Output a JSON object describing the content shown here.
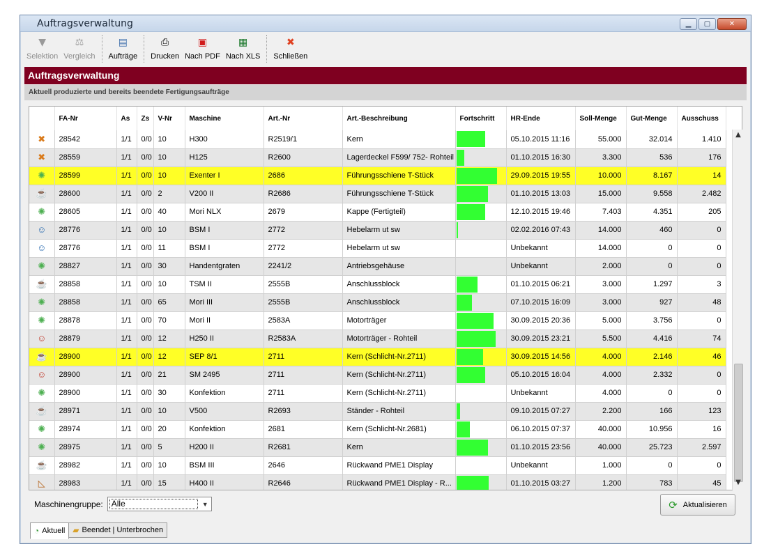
{
  "window": {
    "title": "Auftragsverwaltung"
  },
  "toolbar": [
    {
      "label": "Selektion",
      "icon": "funnel-icon",
      "glyph": "▼",
      "disabled": true
    },
    {
      "label": "Vergleich",
      "icon": "scales-icon",
      "glyph": "⚖",
      "disabled": true
    },
    {
      "label": "Aufträge",
      "icon": "orders-icon",
      "glyph": "▤",
      "disabled": false
    },
    {
      "label": "Drucken",
      "icon": "printer-icon",
      "glyph": "⎙",
      "disabled": false
    },
    {
      "label": "Nach PDF",
      "icon": "pdf-icon",
      "glyph": "▣",
      "disabled": false
    },
    {
      "label": "Nach XLS",
      "icon": "xls-icon",
      "glyph": "▦",
      "disabled": false
    },
    {
      "label": "Schließen",
      "icon": "close-circle-icon",
      "glyph": "✖",
      "disabled": false
    }
  ],
  "band": {
    "title": "Auftragsverwaltung",
    "subtitle": "Aktuell produzierte und bereits beendete Fertigungsaufträge"
  },
  "columns": [
    "",
    "FA-Nr",
    "As",
    "Zs",
    "V-Nr",
    "Maschine",
    "Art.-Nr",
    "Art.-Beschreibung",
    "Fortschritt",
    "HR-Ende",
    "Soll-Menge",
    "Gut-Menge",
    "Ausschuss"
  ],
  "rows": [
    {
      "icon": "stop-icon",
      "glyph": "✖",
      "color": "#d97a1a",
      "fa": "28542",
      "as": "1/1",
      "zs": "0/0",
      "v": "10",
      "maschine": "H300",
      "art": "R2519/1",
      "beschr": "Kern",
      "progress": 0.58,
      "ende": "05.10.2015 11:16",
      "soll": "55.000",
      "gut": "32.014",
      "aus": "1.410",
      "hl": false
    },
    {
      "icon": "stop-icon",
      "glyph": "✖",
      "color": "#d97a1a",
      "fa": "28559",
      "as": "1/1",
      "zs": "0/0",
      "v": "10",
      "maschine": "H125",
      "art": "R2600",
      "beschr": "Lagerdeckel F599/ 752- Rohteil",
      "progress": 0.16,
      "ende": "01.10.2015 16:30",
      "soll": "3.300",
      "gut": "536",
      "aus": "176",
      "hl": false
    },
    {
      "icon": "gear-icon",
      "glyph": "✺",
      "color": "#4caf50",
      "fa": "28599",
      "as": "1/1",
      "zs": "0/0",
      "v": "10",
      "maschine": "Exenter I",
      "art": "2686",
      "beschr": "Führungsschiene T-Stück",
      "progress": 0.82,
      "ende": "29.09.2015 19:55",
      "soll": "10.000",
      "gut": "8.167",
      "aus": "14",
      "hl": true
    },
    {
      "icon": "pause-icon",
      "glyph": "☕",
      "color": "#555555",
      "fa": "28600",
      "as": "1/1",
      "zs": "0/0",
      "v": "2",
      "maschine": "V200 II",
      "art": "R2686",
      "beschr": "Führungsschiene T-Stück",
      "progress": 0.64,
      "ende": "01.10.2015 13:03",
      "soll": "15.000",
      "gut": "9.558",
      "aus": "2.482",
      "hl": false
    },
    {
      "icon": "gear-icon",
      "glyph": "✺",
      "color": "#4caf50",
      "fa": "28605",
      "as": "1/1",
      "zs": "0/0",
      "v": "40",
      "maschine": "Mori NLX",
      "art": "2679",
      "beschr": "Kappe (Fertigteil)",
      "progress": 0.59,
      "ende": "12.10.2015 19:46",
      "soll": "7.403",
      "gut": "4.351",
      "aus": "205",
      "hl": false
    },
    {
      "icon": "worker-icon",
      "glyph": "☺",
      "color": "#2b6cb0",
      "fa": "28776",
      "as": "1/1",
      "zs": "0/0",
      "v": "10",
      "maschine": "BSM I",
      "art": "2772",
      "beschr": "Hebelarm ut sw",
      "progress": 0.03,
      "ende": "02.02.2016 07:43",
      "soll": "14.000",
      "gut": "460",
      "aus": "0",
      "hl": false
    },
    {
      "icon": "worker-icon",
      "glyph": "☺",
      "color": "#2b6cb0",
      "fa": "28776",
      "as": "1/1",
      "zs": "0/0",
      "v": "11",
      "maschine": "BSM I",
      "art": "2772",
      "beschr": "Hebelarm ut sw",
      "progress": 0.0,
      "ende": "Unbekannt",
      "soll": "14.000",
      "gut": "0",
      "aus": "0",
      "hl": false
    },
    {
      "icon": "gear-icon",
      "glyph": "✺",
      "color": "#4caf50",
      "fa": "28827",
      "as": "1/1",
      "zs": "0/0",
      "v": "30",
      "maschine": "Handentgraten",
      "art": "2241/2",
      "beschr": "Antriebsgehäuse",
      "progress": 0.0,
      "ende": "Unbekannt",
      "soll": "2.000",
      "gut": "0",
      "aus": "0",
      "hl": false
    },
    {
      "icon": "pause-icon",
      "glyph": "☕",
      "color": "#555555",
      "fa": "28858",
      "as": "1/1",
      "zs": "0/0",
      "v": "10",
      "maschine": "TSM II",
      "art": "2555B",
      "beschr": "Anschlussblock",
      "progress": 0.43,
      "ende": "01.10.2015 06:21",
      "soll": "3.000",
      "gut": "1.297",
      "aus": "3",
      "hl": false
    },
    {
      "icon": "gear-icon",
      "glyph": "✺",
      "color": "#4caf50",
      "fa": "28858",
      "as": "1/1",
      "zs": "0/0",
      "v": "65",
      "maschine": "Mori III",
      "art": "2555B",
      "beschr": "Anschlussblock",
      "progress": 0.31,
      "ende": "07.10.2015 16:09",
      "soll": "3.000",
      "gut": "927",
      "aus": "48",
      "hl": false
    },
    {
      "icon": "gear-icon",
      "glyph": "✺",
      "color": "#4caf50",
      "fa": "28878",
      "as": "1/1",
      "zs": "0/0",
      "v": "70",
      "maschine": "Mori II",
      "art": "2583A",
      "beschr": "Motorträger",
      "progress": 0.75,
      "ende": "30.09.2015 20:36",
      "soll": "5.000",
      "gut": "3.756",
      "aus": "0",
      "hl": false
    },
    {
      "icon": "worker-stop-icon",
      "glyph": "☺",
      "color": "#c0392b",
      "fa": "28879",
      "as": "1/1",
      "zs": "0/0",
      "v": "12",
      "maschine": "H250 II",
      "art": "R2583A",
      "beschr": "Motorträger - Rohteil",
      "progress": 0.8,
      "ende": "30.09.2015 23:21",
      "soll": "5.500",
      "gut": "4.416",
      "aus": "74",
      "hl": false
    },
    {
      "icon": "pause-icon",
      "glyph": "☕",
      "color": "#555555",
      "fa": "28900",
      "as": "1/1",
      "zs": "0/0",
      "v": "12",
      "maschine": "SEP 8/1",
      "art": "2711",
      "beschr": "Kern (Schlicht-Nr.2711)",
      "progress": 0.54,
      "ende": "30.09.2015 14:56",
      "soll": "4.000",
      "gut": "2.146",
      "aus": "46",
      "hl": true
    },
    {
      "icon": "worker-stop-icon",
      "glyph": "☺",
      "color": "#c0392b",
      "fa": "28900",
      "as": "1/1",
      "zs": "0/0",
      "v": "21",
      "maschine": "SM 2495",
      "art": "2711",
      "beschr": "Kern (Schlicht-Nr.2711)",
      "progress": 0.58,
      "ende": "05.10.2015 16:04",
      "soll": "4.000",
      "gut": "2.332",
      "aus": "0",
      "hl": false
    },
    {
      "icon": "gear-icon",
      "glyph": "✺",
      "color": "#4caf50",
      "fa": "28900",
      "as": "1/1",
      "zs": "0/0",
      "v": "30",
      "maschine": "Konfektion",
      "art": "2711",
      "beschr": "Kern (Schlicht-Nr.2711)",
      "progress": 0.0,
      "ende": "Unbekannt",
      "soll": "4.000",
      "gut": "0",
      "aus": "0",
      "hl": false
    },
    {
      "icon": "pause-icon",
      "glyph": "☕",
      "color": "#555555",
      "fa": "28971",
      "as": "1/1",
      "zs": "0/0",
      "v": "10",
      "maschine": "V500",
      "art": "R2693",
      "beschr": "Ständer - Rohteil",
      "progress": 0.08,
      "ende": "09.10.2015 07:27",
      "soll": "2.200",
      "gut": "166",
      "aus": "123",
      "hl": false
    },
    {
      "icon": "gear-icon",
      "glyph": "✺",
      "color": "#4caf50",
      "fa": "28974",
      "as": "1/1",
      "zs": "0/0",
      "v": "20",
      "maschine": "Konfektion",
      "art": "2681",
      "beschr": "Kern (Schlicht-Nr.2681)",
      "progress": 0.27,
      "ende": "06.10.2015 07:37",
      "soll": "40.000",
      "gut": "10.956",
      "aus": "16",
      "hl": false
    },
    {
      "icon": "gear-icon",
      "glyph": "✺",
      "color": "#4caf50",
      "fa": "28975",
      "as": "1/1",
      "zs": "0/0",
      "v": "5",
      "maschine": "H200 II",
      "art": "R2681",
      "beschr": "Kern",
      "progress": 0.64,
      "ende": "01.10.2015 23:56",
      "soll": "40.000",
      "gut": "25.723",
      "aus": "2.597",
      "hl": false
    },
    {
      "icon": "pause-icon",
      "glyph": "☕",
      "color": "#555555",
      "fa": "28982",
      "as": "1/1",
      "zs": "0/0",
      "v": "10",
      "maschine": "BSM III",
      "art": "2646",
      "beschr": "Rückwand PME1 Display",
      "progress": 0.0,
      "ende": "Unbekannt",
      "soll": "1.000",
      "gut": "0",
      "aus": "0",
      "hl": false
    },
    {
      "icon": "setup-icon",
      "glyph": "◺",
      "color": "#b5651d",
      "fa": "28983",
      "as": "1/1",
      "zs": "0/0",
      "v": "15",
      "maschine": "H400 II",
      "art": "R2646",
      "beschr": "Rückwand PME1 Display - R...",
      "progress": 0.65,
      "ende": "01.10.2015 03:27",
      "soll": "1.200",
      "gut": "783",
      "aus": "45",
      "hl": false
    }
  ],
  "filter": {
    "label": "Maschinengruppe:",
    "value": "Alle"
  },
  "refresh": {
    "label": "Aktualisieren"
  },
  "tabs": [
    {
      "label": "Aktuell",
      "active": true
    },
    {
      "label": "Beendet | Unterbrochen",
      "active": false
    }
  ]
}
